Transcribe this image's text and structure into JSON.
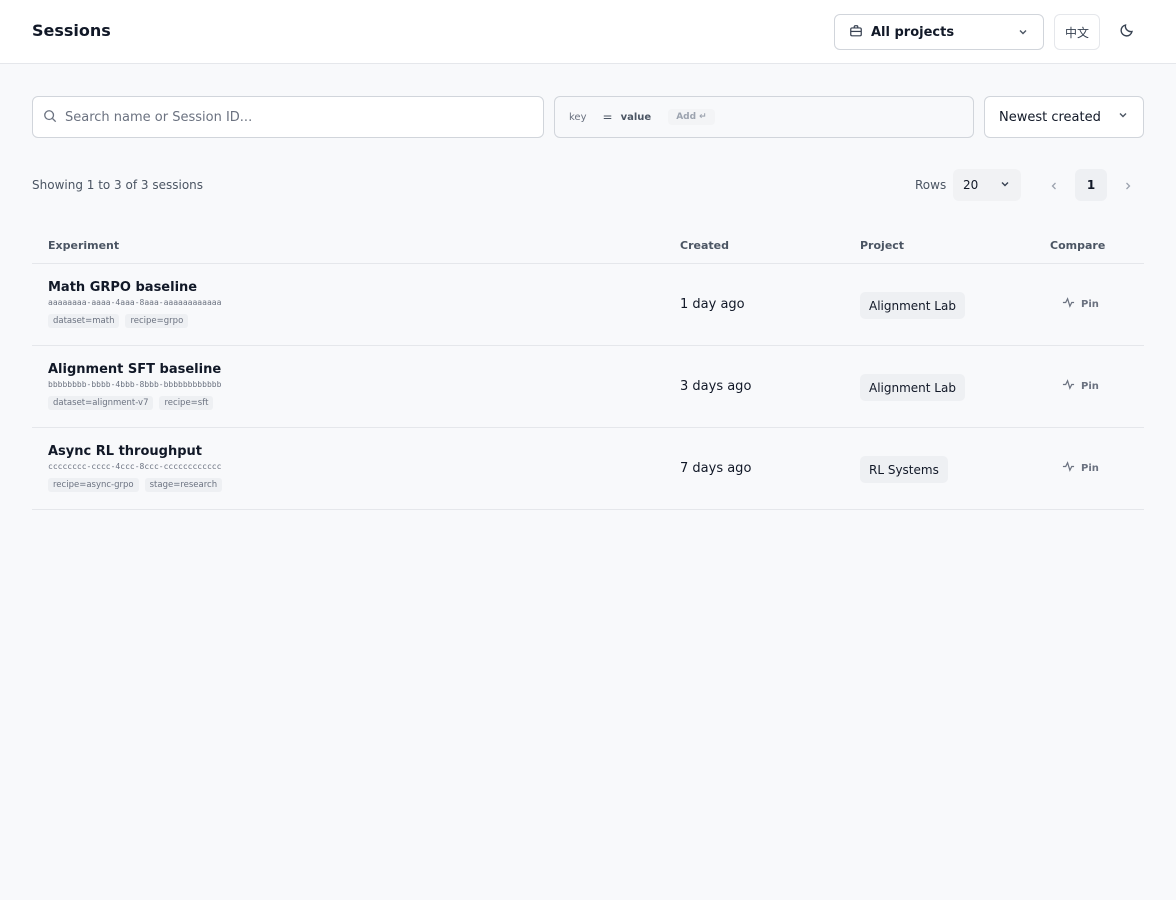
{
  "header": {
    "title": "Sessions",
    "project_selector": {
      "icon": "briefcase-icon",
      "label": "All projects"
    },
    "language_button": "中文",
    "theme_toggle_icon": "moon-icon"
  },
  "filters": {
    "search": {
      "placeholder": "Search name or Session ID...",
      "value": ""
    },
    "tag_filter": {
      "key_placeholder": "key",
      "operator": "=",
      "value_placeholder": "value",
      "add_label": "Add ↵"
    },
    "sort": {
      "label": "Newest created"
    }
  },
  "pagination": {
    "summary": "Showing 1 to 3 of 3 sessions",
    "rows_label": "Rows",
    "rows_value": "20",
    "current_page": "1"
  },
  "table": {
    "columns": [
      "Experiment",
      "Created",
      "Project",
      "Compare"
    ],
    "rows": [
      {
        "name": "Math GRPO baseline",
        "id": "aaaaaaaa-aaaa-4aaa-8aaa-aaaaaaaaaaaa",
        "tags": [
          "dataset=math",
          "recipe=grpo"
        ],
        "created": "1 day ago",
        "project": "Alignment Lab",
        "action": "Pin"
      },
      {
        "name": "Alignment SFT baseline",
        "id": "bbbbbbbb-bbbb-4bbb-8bbb-bbbbbbbbbbbb",
        "tags": [
          "dataset=alignment-v7",
          "recipe=sft"
        ],
        "created": "3 days ago",
        "project": "Alignment Lab",
        "action": "Pin"
      },
      {
        "name": "Async RL throughput",
        "id": "cccccccc-cccc-4ccc-8ccc-cccccccccccc",
        "tags": [
          "recipe=async-grpo",
          "stage=research"
        ],
        "created": "7 days ago",
        "project": "RL Systems",
        "action": "Pin"
      }
    ]
  }
}
